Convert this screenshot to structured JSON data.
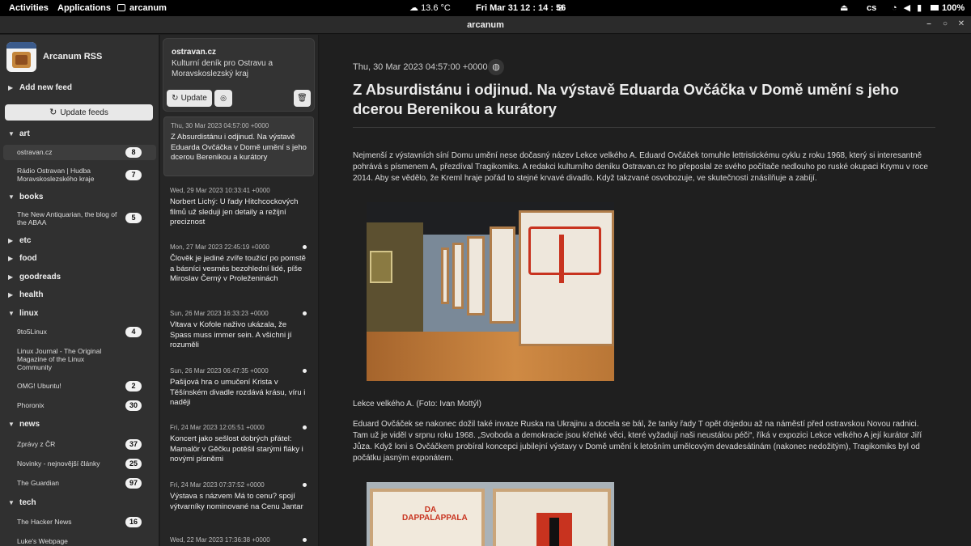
{
  "topbar": {
    "activities": "Activities",
    "applications": "Applications",
    "app": "arcanum",
    "weather": "13.6 °C",
    "clock": "Fri Mar 31  12 : 14 : 56",
    "language": "cs",
    "battery": "100%"
  },
  "window": {
    "title": "arcanum"
  },
  "sidebar": {
    "app_name": "Arcanum RSS",
    "add_feed": "Add new feed",
    "update_feeds": "Update feeds",
    "categories": [
      {
        "name": "art",
        "expanded": true,
        "feeds": [
          {
            "name": "ostravan.cz",
            "count": "8",
            "selected": true
          },
          {
            "name": "Rádio Ostravan | Hudba Moravskoslezského kraje",
            "count": "7"
          }
        ]
      },
      {
        "name": "books",
        "expanded": true,
        "feeds": [
          {
            "name": "The New Antiquarian, the blog of the ABAA",
            "count": "5"
          }
        ]
      },
      {
        "name": "etc",
        "expanded": false,
        "feeds": []
      },
      {
        "name": "food",
        "expanded": false,
        "feeds": []
      },
      {
        "name": "goodreads",
        "expanded": false,
        "feeds": []
      },
      {
        "name": "health",
        "expanded": false,
        "feeds": []
      },
      {
        "name": "linux",
        "expanded": true,
        "feeds": [
          {
            "name": "9to5Linux",
            "count": "4"
          },
          {
            "name": "Linux Journal - The Original Magazine of the Linux Community",
            "count": ""
          },
          {
            "name": "OMG! Ubuntu!",
            "count": "2"
          },
          {
            "name": "Phoronix",
            "count": "30"
          }
        ]
      },
      {
        "name": "news",
        "expanded": true,
        "feeds": [
          {
            "name": "Zprávy z ČR",
            "count": "37"
          },
          {
            "name": "Novinky - nejnovější články",
            "count": "25"
          },
          {
            "name": "The Guardian",
            "count": "97"
          }
        ]
      },
      {
        "name": "tech",
        "expanded": true,
        "feeds": [
          {
            "name": "The Hacker News",
            "count": "16"
          },
          {
            "name": "Luke's Webpage",
            "count": ""
          }
        ]
      }
    ]
  },
  "feed_header": {
    "title": "ostravan.cz",
    "description": "Kulturní deník pro Ostravu a Moravskoslezský kraj",
    "update_label": "Update"
  },
  "articles": [
    {
      "date": "Thu, 30 Mar 2023 04:57:00 +0000",
      "title": "Z Absurdistánu i odjinud. Na výstavě Eduarda Ovčáčka v Domě umění s jeho dcerou Berenikou a kurátory",
      "unread": false,
      "selected": true
    },
    {
      "date": "Wed, 29 Mar 2023 10:33:41 +0000",
      "title": "Norbert Lichý: U řady Hitchcockových filmů už sleduji jen detaily a režijní preciznost",
      "unread": false
    },
    {
      "date": "Mon, 27 Mar 2023 22:45:19 +0000",
      "title": "Člověk je jediné zvíře toužící po pomstě a básníci vesmés bezohlední lidé, píše Miroslav Černý v Proleženinách",
      "unread": true
    },
    {
      "date": "Sun, 26 Mar 2023 16:33:23 +0000",
      "title": "Vltava v Kofole naživo ukázala, že Spass muss immer sein. A všichni jí rozuměli",
      "unread": true
    },
    {
      "date": "Sun, 26 Mar 2023 06:47:35 +0000",
      "title": "Pašijová hra o umučení Krista v Těšínském divadle rozdává krásu, víru i naději",
      "unread": true
    },
    {
      "date": "Fri, 24 Mar 2023 12:05:51 +0000",
      "title": "Koncert jako sešlost dobrých přátel: Mamalör v Gěčku potěšil starými fláky i novými písněmi",
      "unread": true
    },
    {
      "date": "Fri, 24 Mar 2023 07:37:52 +0000",
      "title": "Výstava s názvem Má to cenu? spojí výtvarníky nominované na Cenu Jantar",
      "unread": true
    },
    {
      "date": "Wed, 22 Mar 2023 17:36:38 +0000",
      "title": "",
      "unread": true
    }
  ],
  "reader": {
    "date": "Thu, 30 Mar 2023 04:57:00 +0000",
    "title": "Z Absurdistánu i odjinud. Na výstavě Eduarda Ovčáčka v Domě umění s jeho dcerou Berenikou a kurátory",
    "paragraph1": "Nejmenší z výstavních síní Domu umění nese dočasný název Lekce velkého A. Eduard Ovčáček tomuhle lettristickému cyklu z roku 1968, který si interesantně pohrává s písmenem A, přezdíval Tragikomiks. A redakci kulturního deníku Ostravan.cz ho přeposlal ze svého počítače nedlouho po ruské okupaci Krymu v roce 2014. Aby se vědělo, že Kreml hraje pořád to stejné krvavé divadlo. Když takzvané osvobozuje, ve skutečnosti znásilňuje a zabíjí.",
    "caption": "Lekce velkého A. (Foto: Ivan Mottýl)",
    "paragraph2": "Eduard Ovčáček se nakonec dožil také invaze Ruska na Ukrajinu a docela se bál, že tanky řady T opět dojedou až na náměstí před ostravskou Novou radnici. Tam už je viděl v srpnu roku 1968. „Svoboda a demokracie jsou křehké věci, které vyžadují naši neustálou péči“, říká v expozici Lekce velkého A její kurátor Jiří Jůza. Když loni s Ovčáčkem probíral koncepci jubilejní výstavy v Domě umění k letošním umělcovým devadesátinám (nakonec nedožitým), Tragikomiks byl od počátku jasným exponátem.",
    "photo2_text": "DA DAPPALAPPALA"
  },
  "colors": {
    "accent": "#e8e8e8",
    "unread_dot": "#f0f0f0",
    "sidebar_bg": "#303030",
    "reader_bg": "#1f1f1f"
  },
  "icons": [
    "app-logo-icon",
    "refresh-icon",
    "mark-read-icon",
    "trash-icon",
    "globe-icon",
    "wifi-icon",
    "volume-icon",
    "mic-icon",
    "battery-icon",
    "eject-icon",
    "weather-icon",
    "no-network-icon"
  ]
}
